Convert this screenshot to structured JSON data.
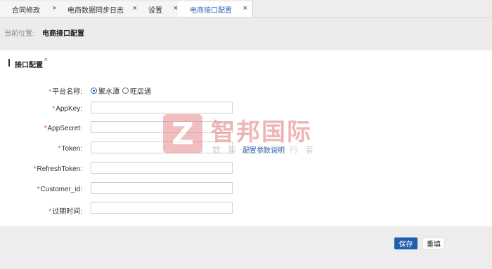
{
  "tabs": [
    {
      "label": "合同修改",
      "close": "×"
    },
    {
      "label": "电商数据同步日志",
      "close": "×"
    },
    {
      "label": "设置",
      "close": "×"
    },
    {
      "label": "电商接口配置",
      "close": "×",
      "active": true
    }
  ],
  "breadcrumb": {
    "label": "当前位置:",
    "value": "电商接口配置"
  },
  "section": {
    "title": "接口配置",
    "caret": "^"
  },
  "form": {
    "platform": {
      "label": "平台名称:",
      "required": "*",
      "options": [
        "聚水潭",
        "旺店通"
      ],
      "selected": "聚水潭"
    },
    "appkey": {
      "label": "AppKey:",
      "required": "*",
      "value": ""
    },
    "appsecret": {
      "label": "AppSecret:",
      "required": "*",
      "value": ""
    },
    "token": {
      "label": "Token:",
      "required": "*",
      "value": ""
    },
    "refreshtoken": {
      "label": "RefreshToken:",
      "required": "*",
      "value": ""
    },
    "customer_id": {
      "label": "Customer_id:",
      "required": "*",
      "value": ""
    },
    "expire": {
      "label": "过期时间:",
      "required": "*",
      "value": ""
    }
  },
  "help_link": "配置参数说明",
  "buttons": {
    "save": "保存",
    "reset": "重填"
  },
  "watermark": {
    "logo_letter": "Z",
    "title": "智邦国际",
    "subtitle": "数智驱动先行者"
  },
  "colors": {
    "primary": "#1f5fad",
    "active_tab": "#2c67b6",
    "required": "#e23b3b",
    "watermark": "#e5898a"
  }
}
